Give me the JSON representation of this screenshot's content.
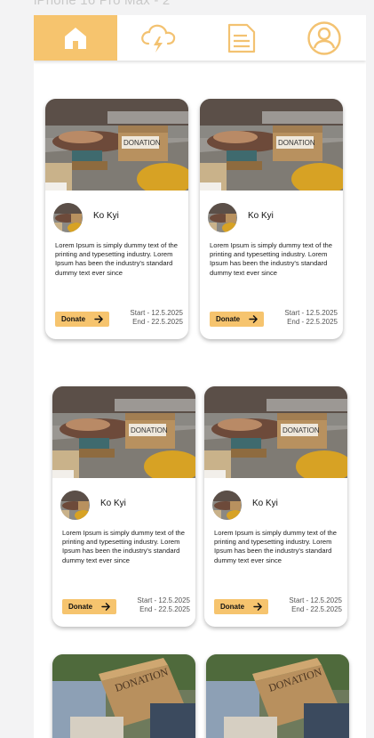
{
  "frame_label": "iPhone 16 Pro Max - 2",
  "nav": {
    "tabs": [
      {
        "icon": "home-icon",
        "active": true
      },
      {
        "icon": "cloud-lightning-icon",
        "active": false
      },
      {
        "icon": "document-icon",
        "active": false
      },
      {
        "icon": "user-profile-icon",
        "active": false
      }
    ],
    "accent_color": "#f6c46e"
  },
  "cards": [
    {
      "name": "Ko Kyi",
      "desc": "Lorem Ipsum is simply dummy text of the printing and typesetting industry. Lorem Ipsum has been the industry's standard dummy text ever since",
      "donate_label": "Donate",
      "start": "Start - 12.5.2025",
      "end": "End - 22.5.2025",
      "photo_label": "DONATION"
    },
    {
      "name": "Ko Kyi",
      "desc": "Lorem Ipsum is simply dummy text of the printing and typesetting industry. Lorem Ipsum has been the industry's standard dummy text ever since",
      "donate_label": "Donate",
      "start": "Start - 12.5.2025",
      "end": "End - 22.5.2025",
      "photo_label": "DONATION"
    },
    {
      "name": "Ko Kyi",
      "desc": "Lorem Ipsum is simply dummy text of the printing and typesetting industry. Lorem Ipsum has been the industry's standard dummy text ever since",
      "donate_label": "Donate",
      "start": "Start - 12.5.2025",
      "end": "End - 22.5.2025",
      "photo_label": "DONATION"
    },
    {
      "name": "Ko Kyi",
      "desc": "Lorem Ipsum is simply dummy text of the printing and typesetting industry. Lorem Ipsum has been the industry's standard dummy text ever since",
      "donate_label": "Donate",
      "start": "Start - 12.5.2025",
      "end": "End - 22.5.2025",
      "photo_label": "DONATION"
    },
    {
      "photo_label": "DONATION"
    },
    {
      "photo_label": "DONATION"
    }
  ]
}
